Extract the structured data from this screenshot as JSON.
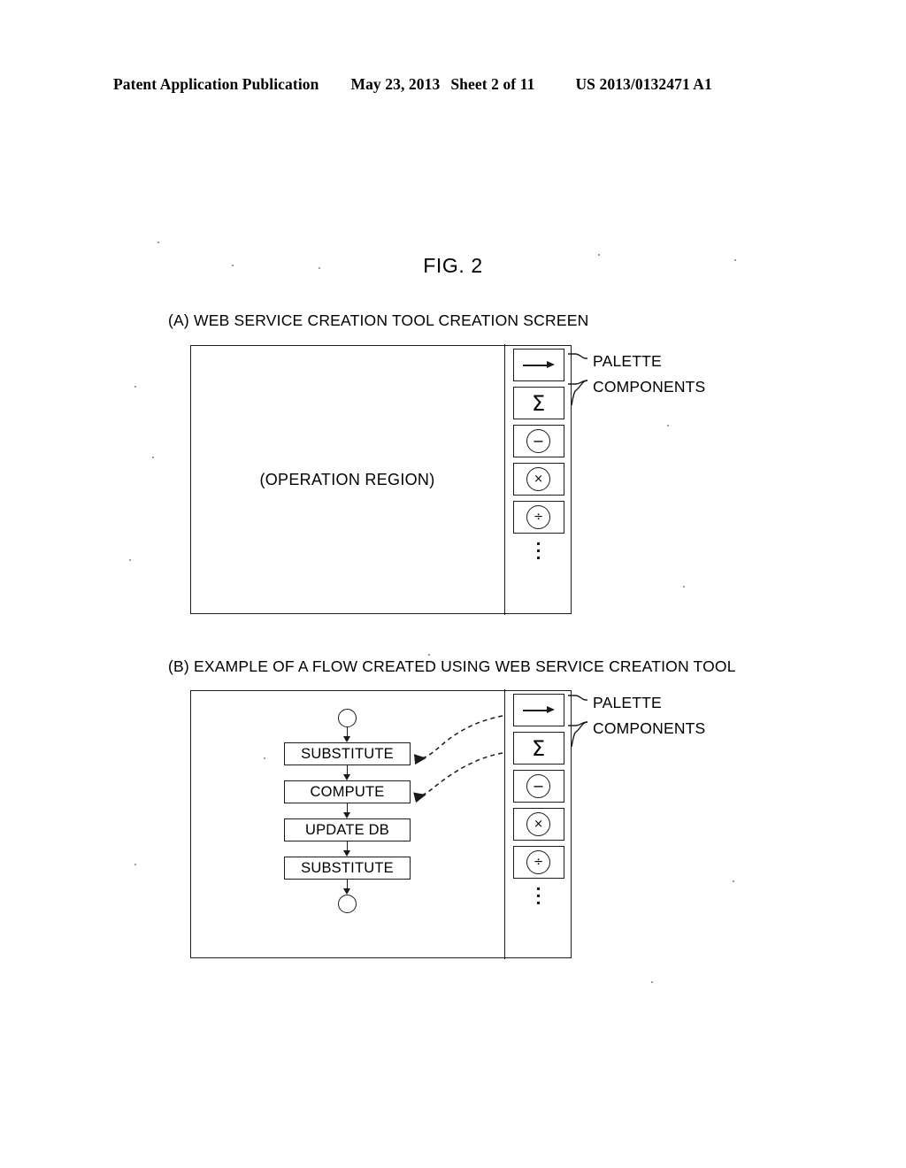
{
  "header": {
    "publication": "Patent Application Publication",
    "date": "May 23, 2013",
    "sheet": "Sheet 2 of 11",
    "document_number": "US 2013/0132471 A1"
  },
  "figure": {
    "title": "FIG. 2"
  },
  "panel_a": {
    "caption": "(A) WEB SERVICE CREATION TOOL CREATION SCREEN",
    "operation_region_label": "(OPERATION REGION)",
    "callouts": {
      "palette": "PALETTE",
      "components": "COMPONENTS"
    },
    "palette_items": [
      {
        "icon": "arrow-right-icon",
        "glyph": ""
      },
      {
        "icon": "sigma-icon",
        "glyph": "Σ"
      },
      {
        "icon": "circled-minus-icon",
        "glyph": "−"
      },
      {
        "icon": "circled-multiply-icon",
        "glyph": "×"
      },
      {
        "icon": "circled-divide-icon",
        "glyph": "÷"
      }
    ],
    "palette_more_indicator": "vertical-ellipsis"
  },
  "panel_b": {
    "caption": "(B) EXAMPLE OF A FLOW CREATED USING WEB SERVICE CREATION TOOL",
    "callouts": {
      "palette": "PALETTE",
      "components": "COMPONENTS"
    },
    "palette_items": [
      {
        "icon": "arrow-right-icon",
        "glyph": ""
      },
      {
        "icon": "sigma-icon",
        "glyph": "Σ"
      },
      {
        "icon": "circled-minus-icon",
        "glyph": "−"
      },
      {
        "icon": "circled-multiply-icon",
        "glyph": "×"
      },
      {
        "icon": "circled-divide-icon",
        "glyph": "÷"
      }
    ],
    "palette_more_indicator": "vertical-ellipsis",
    "flow": {
      "start_node": "start-terminal",
      "end_node": "end-terminal",
      "steps": [
        {
          "label": "SUBSTITUTE"
        },
        {
          "label": "COMPUTE"
        },
        {
          "label": "UPDATE DB"
        },
        {
          "label": "SUBSTITUTE"
        }
      ],
      "drag_connections": [
        {
          "from": "arrow-right-icon",
          "to": "SUBSTITUTE"
        },
        {
          "from": "sigma-icon",
          "to": "COMPUTE"
        }
      ]
    }
  },
  "colors": {
    "ink": "#1a1a1a",
    "paper": "#ffffff"
  }
}
